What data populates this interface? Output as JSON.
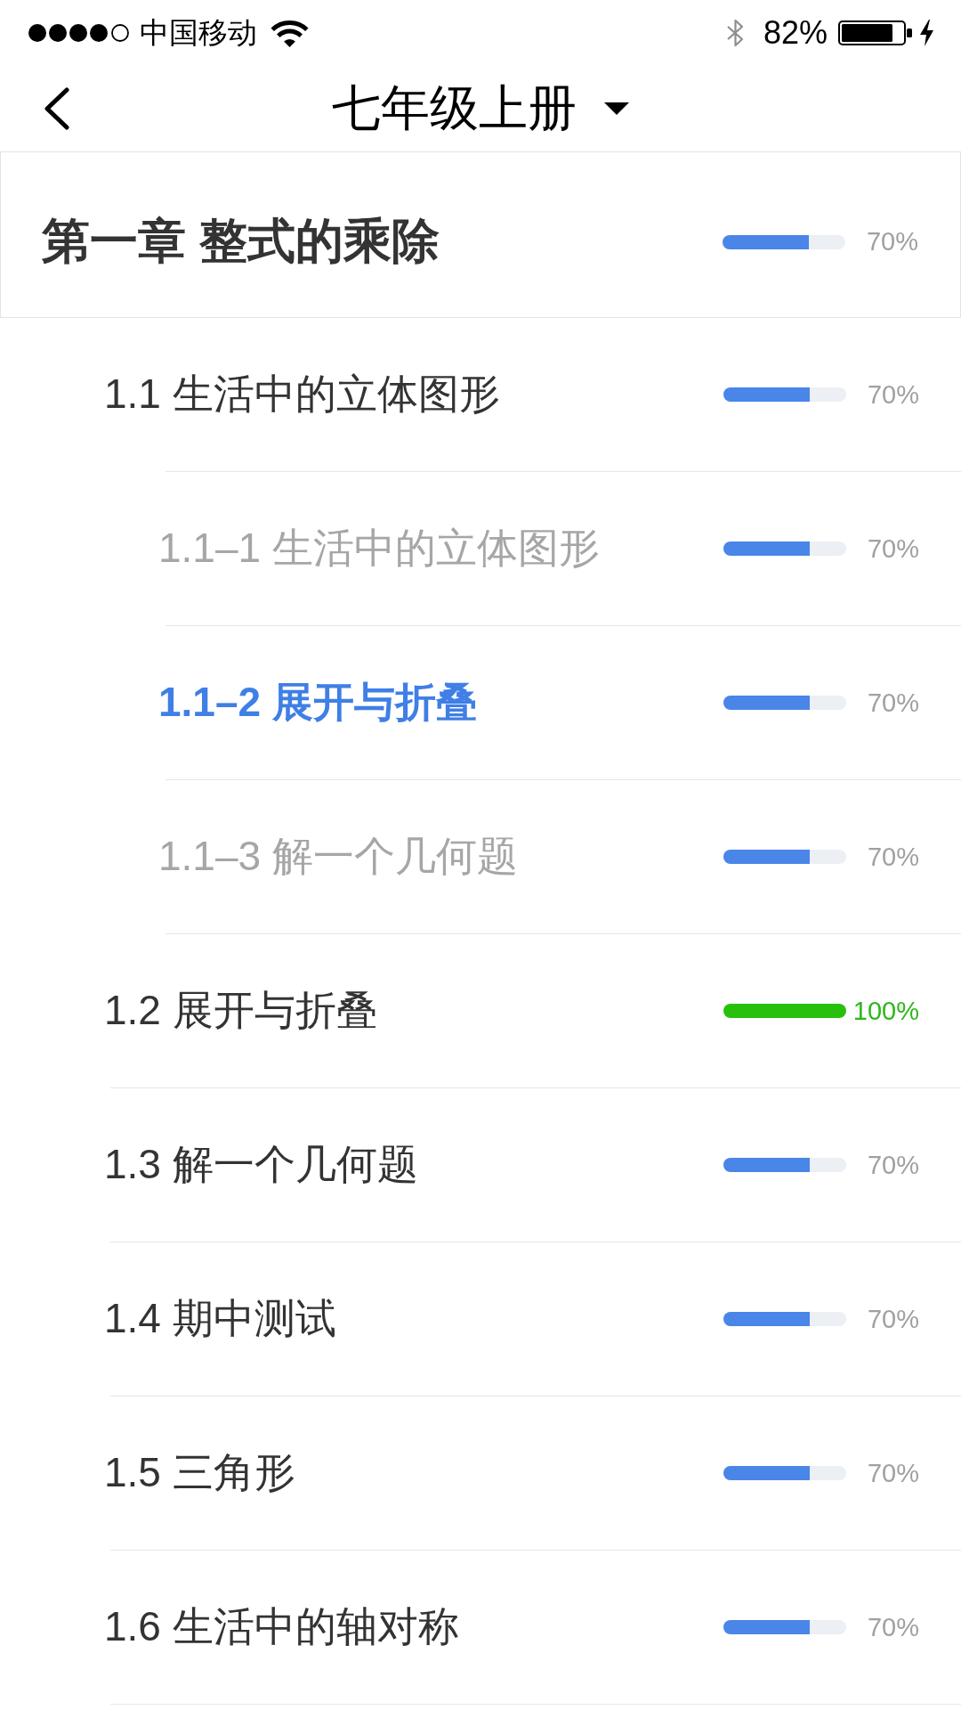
{
  "status_bar": {
    "carrier": "中国移动",
    "battery_percent": "82%"
  },
  "nav": {
    "title": "七年级上册"
  },
  "chapter": {
    "title": "第一章 整式的乘除",
    "level": 0.7,
    "percent": "70%"
  },
  "sections": [
    {
      "title": "1.1 生活中的立体图形",
      "level": 0.7,
      "percent": "70%",
      "children": [
        {
          "title": "1.1–1 生活中的立体图形",
          "level": 0.7,
          "percent": "70%",
          "selected": false
        },
        {
          "title": "1.1–2 展开与折叠",
          "level": 0.7,
          "percent": "70%",
          "selected": true
        },
        {
          "title": "1.1–3 解一个几何题",
          "level": 0.7,
          "percent": "70%",
          "selected": false
        }
      ]
    },
    {
      "title": "1.2 展开与折叠",
      "level": 1,
      "percent": "100%"
    },
    {
      "title": "1.3 解一个几何题",
      "level": 0.7,
      "percent": "70%"
    },
    {
      "title": "1.4 期中测试",
      "level": 0.7,
      "percent": "70%"
    },
    {
      "title": "1.5 三角形",
      "level": 0.7,
      "percent": "70%"
    },
    {
      "title": "1.6 生活中的轴对称",
      "level": 0.7,
      "percent": "70%"
    }
  ]
}
